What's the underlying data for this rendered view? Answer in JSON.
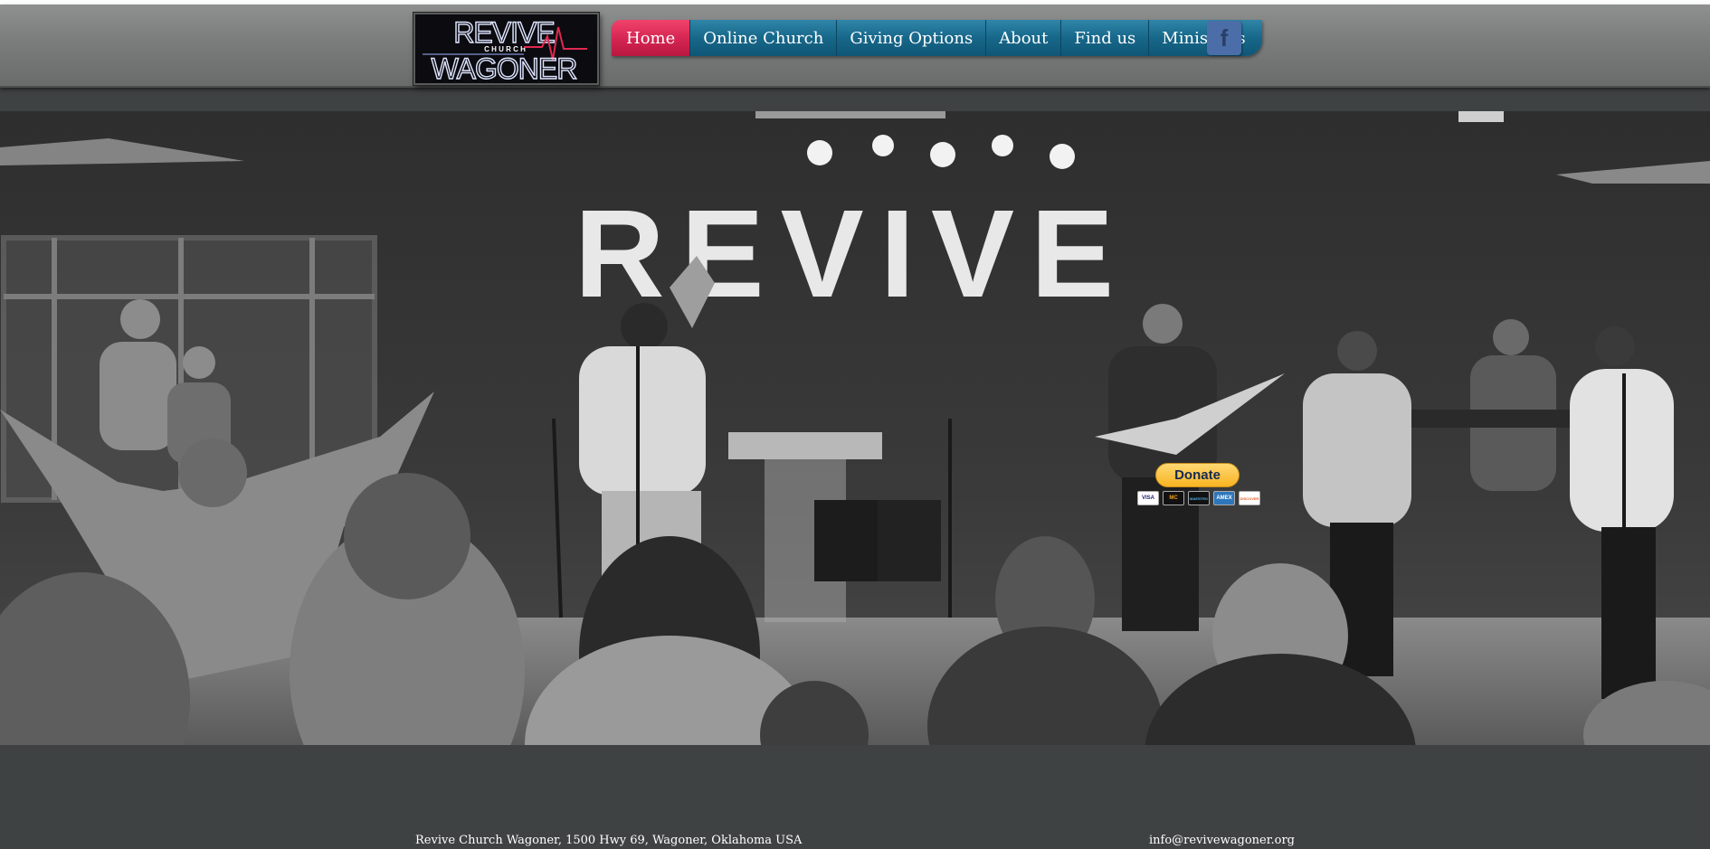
{
  "logo": {
    "line1": "REVIVE",
    "line2": "C H U R C H",
    "line3": "WAGONER"
  },
  "nav": {
    "items": [
      {
        "label": "Home",
        "active": true
      },
      {
        "label": "Online Church"
      },
      {
        "label": "Giving Options"
      },
      {
        "label": "About"
      },
      {
        "label": "Find us"
      },
      {
        "label": "Ministries"
      }
    ],
    "social_icon": "facebook-icon",
    "social_glyph": "f"
  },
  "hero": {
    "stage_sign": "REVIVE",
    "image_description_icon": "worship-band-photo"
  },
  "donate": {
    "label": "Donate",
    "cards": [
      "VISA",
      "MC",
      "MAESTRO",
      "AMEX",
      "DISCOVER"
    ]
  },
  "footer": {
    "address": "Revive Church Wagoner, 1500 Hwy 69, Wagoner, Oklahoma USA",
    "email": "info@revivewagoner.org"
  },
  "colors": {
    "nav_active": "#d42452",
    "nav_default": "#17678a",
    "page_bg": "#3f4242",
    "facebook": "#4b6ea8"
  }
}
